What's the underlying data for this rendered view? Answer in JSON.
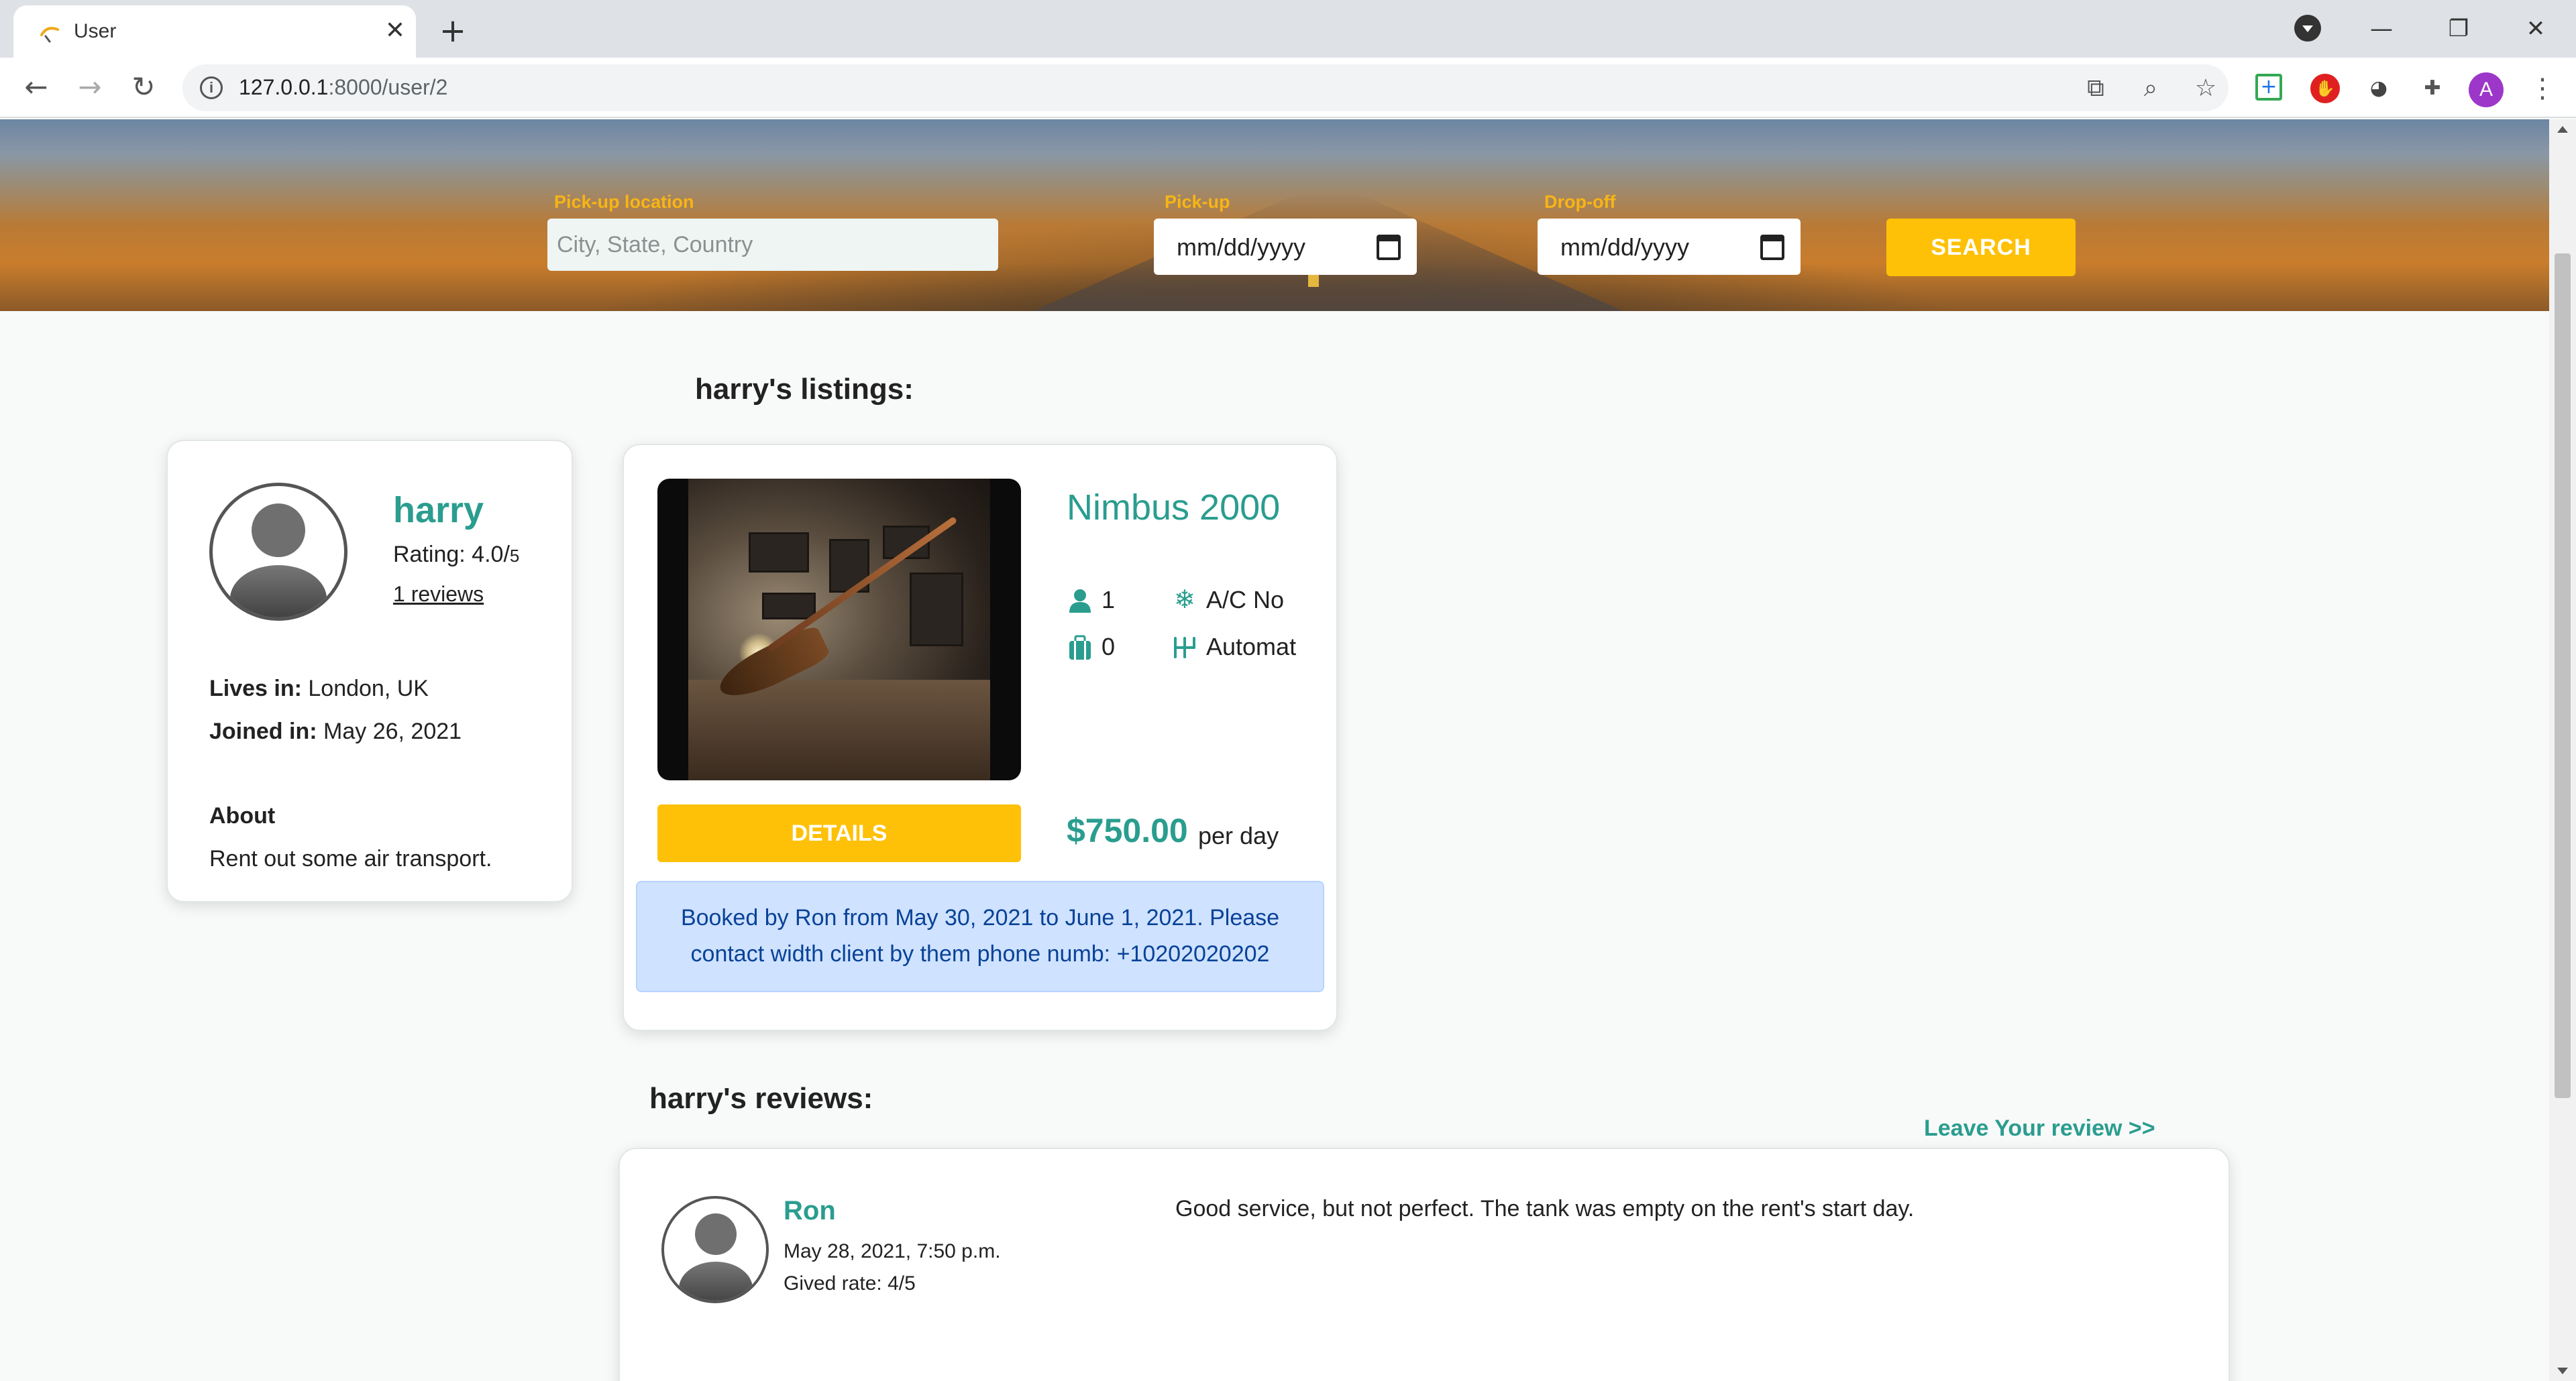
{
  "browser": {
    "tab_title": "User",
    "url_host": "127.0.0.1",
    "url_path": ":8000/user/2",
    "profile_initial": "A"
  },
  "search": {
    "location_label": "Pick-up location",
    "location_placeholder": "City, State, Country",
    "pickup_label": "Pick-up",
    "pickup_value": "mm/dd/yyyy",
    "dropoff_label": "Drop-off",
    "dropoff_value": "mm/dd/yyyy",
    "button_label": "SEARCH"
  },
  "profile": {
    "name": "harry",
    "rating": "Rating: 4.0/",
    "rating_max": "5",
    "reviews_link": "1 reviews",
    "lives_label": "Lives in:",
    "lives_value": "London, UK",
    "joined_label": "Joined in:",
    "joined_value": "May 26, 2021",
    "about_label": "About",
    "about_text": "Rent out some air transport."
  },
  "listings": {
    "heading": "harry's listings:",
    "items": [
      {
        "title": "Nimbus 2000",
        "seats": "1",
        "ac": "A/C No",
        "luggage": "0",
        "transmission": "Automat",
        "details_label": "DETAILS",
        "price": "$750.00",
        "price_unit": "per day",
        "booking_line1": "Booked by Ron from May 30, 2021 to June 1, 2021. Please",
        "booking_line2": "contact width client by them phone numb: +10202020202"
      }
    ]
  },
  "reviews": {
    "heading": "harry's reviews:",
    "leave_link": "Leave Your review >>",
    "items": [
      {
        "author": "Ron",
        "date": "May 28, 2021, 7:50 p.m.",
        "rate": "Gived rate: 4/5",
        "text": "Good service, but not perfect. The tank was empty on the rent's start day."
      }
    ]
  },
  "colors": {
    "accent": "#2a9d8f",
    "button": "#fec107",
    "label": "#f7b515",
    "alert_bg": "#cfe2ff",
    "alert_text": "#084298"
  }
}
